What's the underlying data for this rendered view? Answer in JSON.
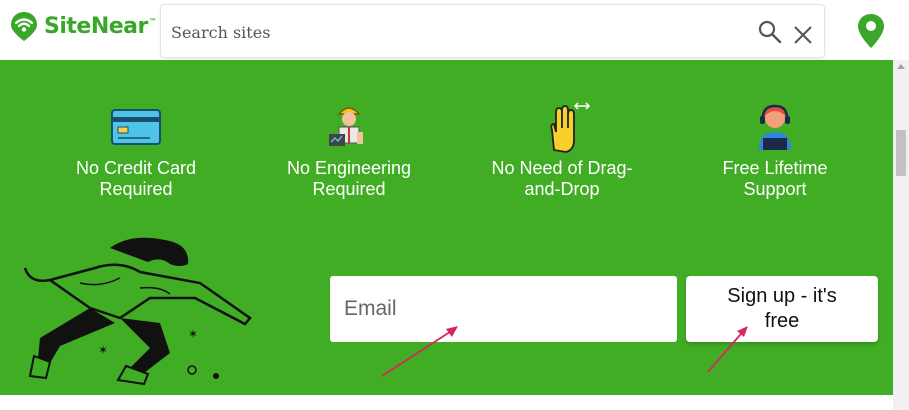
{
  "header": {
    "logo_text": "SiteNear",
    "logo_tm": "™",
    "search": {
      "placeholder": "Search sites",
      "value": ""
    }
  },
  "icons": {
    "logo": "wifi-pin-logo-icon",
    "search": "search-icon",
    "clear": "close-icon",
    "location": "map-pin-icon",
    "features": [
      "credit-card-icon",
      "engineer-icon",
      "hand-drag-icon",
      "support-agent-icon"
    ]
  },
  "banner": {
    "features": [
      {
        "label_line1": "No Credit Card",
        "label_line2": "Required"
      },
      {
        "label_line1": "No Engineering",
        "label_line2": "Required"
      },
      {
        "label_line1": "No Need of Drag-",
        "label_line2": "and-Drop"
      },
      {
        "label_line1": "Free Lifetime",
        "label_line2": "Support"
      }
    ],
    "email_placeholder": "Email",
    "signup_label_line1": "Sign up - it's",
    "signup_label_line2": "free"
  },
  "colors": {
    "brand_green": "#3aa62a",
    "banner_green": "#41ad25",
    "annotation_arrow": "#d8275a"
  }
}
